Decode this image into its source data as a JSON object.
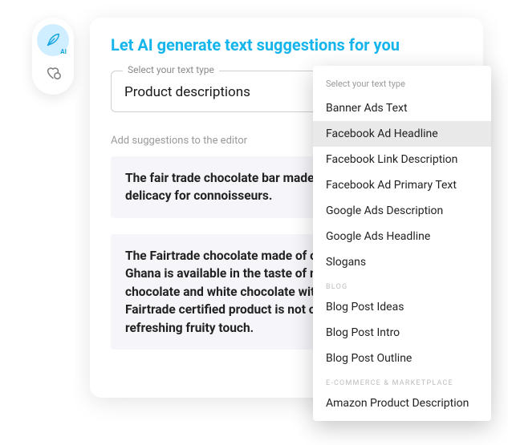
{
  "toolbar": {
    "ai_label": "AI"
  },
  "panel": {
    "title": "Let AI generate text suggestions for you",
    "select_legend": "Select your text type",
    "select_value": "Product descriptions",
    "subheading": "Add suggestions to the editor",
    "suggestions": [
      "The fair trade chocolate bar made of organic cocoa is a delicacy for connoisseurs.",
      "The Fairtrade chocolate made of organic cocoa from Ghana is available in the taste of milk chocolate, dark chocolate and white chocolate with raspberries. The Fairtrade certified product is not only fair, but also a refreshing fruity touch."
    ]
  },
  "dropdown": {
    "label": "Select your text type",
    "groups": [
      {
        "category": null,
        "items": [
          {
            "label": "Banner Ads Text",
            "hover": false
          },
          {
            "label": "Facebook Ad Headline",
            "hover": true
          },
          {
            "label": "Facebook Link Description",
            "hover": false
          },
          {
            "label": "Facebook Ad Primary Text",
            "hover": false
          },
          {
            "label": "Google Ads Description",
            "hover": false
          },
          {
            "label": "Google Ads Headline",
            "hover": false
          },
          {
            "label": "Slogans",
            "hover": false
          }
        ]
      },
      {
        "category": "BLOG",
        "items": [
          {
            "label": "Blog Post Ideas",
            "hover": false
          },
          {
            "label": "Blog Post Intro",
            "hover": false
          },
          {
            "label": "Blog Post Outline",
            "hover": false
          }
        ]
      },
      {
        "category": "E-COMMERCE & MARKETPLACE",
        "items": [
          {
            "label": "Amazon Product Description",
            "hover": false
          }
        ]
      }
    ]
  }
}
